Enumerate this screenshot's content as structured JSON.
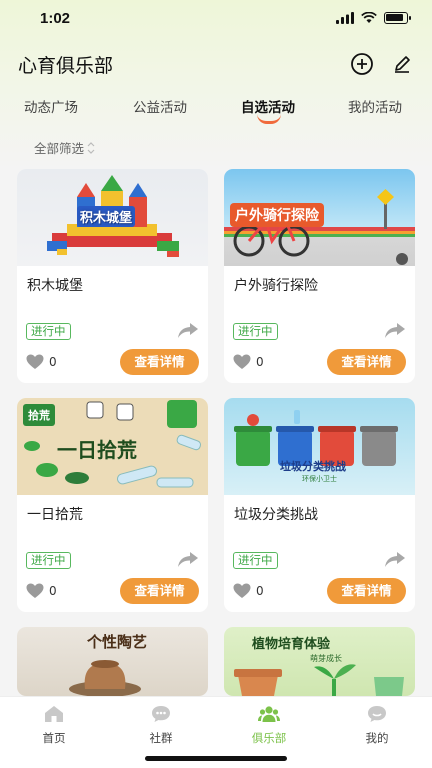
{
  "status_bar": {
    "time": "1:02"
  },
  "header": {
    "title": "心育俱乐部"
  },
  "tabs": [
    {
      "label": "动态广场"
    },
    {
      "label": "公益活动"
    },
    {
      "label": "自选活动"
    },
    {
      "label": "我的活动"
    }
  ],
  "active_tab": "自选活动",
  "filter": {
    "label": "全部筛选"
  },
  "cards": [
    {
      "name": "积木城堡",
      "image_text": "积木城堡",
      "status": "进行中",
      "likes": "0",
      "detail_label": "查看详情"
    },
    {
      "name": "户外骑行探险",
      "image_text": "户外骑行探险",
      "status": "进行中",
      "likes": "0",
      "detail_label": "查看详情"
    },
    {
      "name": "一日拾荒",
      "image_text": "一日拾荒",
      "image_badge": "拾荒",
      "status": "进行中",
      "likes": "0",
      "detail_label": "查看详情"
    },
    {
      "name": "垃圾分类挑战",
      "image_text": "垃圾分类挑战",
      "image_subtext": "环保小卫士",
      "status": "进行中",
      "likes": "0",
      "detail_label": "查看详情"
    },
    {
      "name": "个性陶艺",
      "image_text": "个性陶艺"
    },
    {
      "name": "植物培育体验",
      "image_text": "植物培育体验",
      "image_subtext": "萌芽成长"
    }
  ],
  "bottom_nav": [
    {
      "label": "首页",
      "icon": "home-icon"
    },
    {
      "label": "社群",
      "icon": "chat-icon"
    },
    {
      "label": "俱乐部",
      "icon": "club-icon"
    },
    {
      "label": "我的",
      "icon": "profile-icon"
    }
  ],
  "colors": {
    "accent": "#f09a3a",
    "active_nav": "#7cc24a",
    "status_green": "#3ea846",
    "tab_indicator": "#f06a3c"
  }
}
